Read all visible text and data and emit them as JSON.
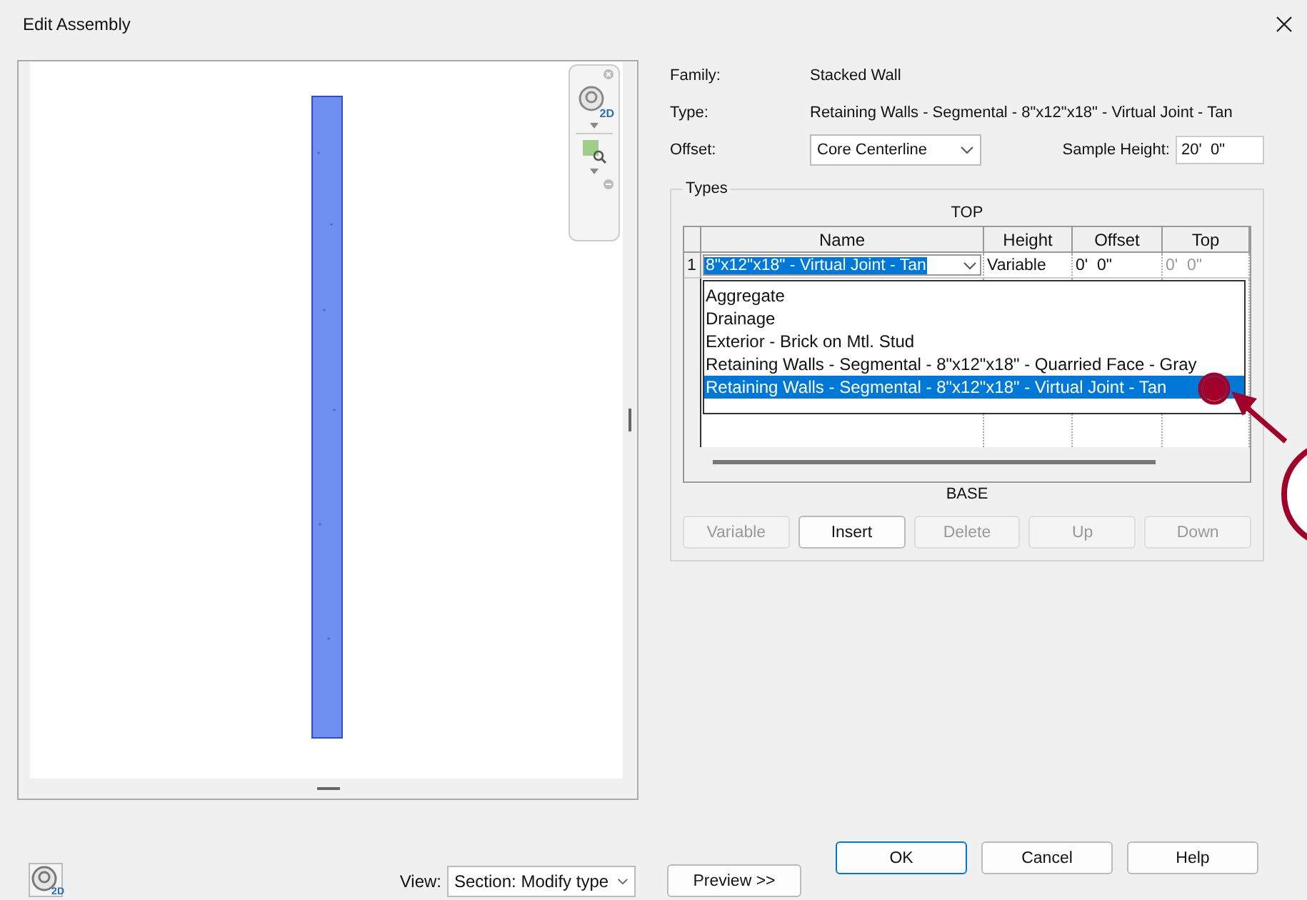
{
  "window": {
    "title": "Edit Assembly"
  },
  "preview": {
    "nav_bar_label": "2D",
    "view_label": "View:",
    "view_value": "Section: Modify type",
    "corner_label": "2D"
  },
  "properties": [
    {
      "label": "Family:",
      "value": "Stacked Wall",
      "kind": "text"
    },
    {
      "label": "Type:",
      "value": "Retaining Walls - Segmental - 8\"x12\"x18\" - Virtual Joint - Tan",
      "kind": "text"
    },
    {
      "label": "Offset:",
      "value": "Core Centerline",
      "kind": "dropdown"
    }
  ],
  "sample_height": {
    "label": "Sample Height:",
    "value": "20'  0\""
  },
  "types": {
    "title": "Types",
    "top_label": "TOP",
    "base_label": "BASE",
    "columns": [
      "Name",
      "Height",
      "Offset",
      "Top"
    ],
    "rows": [
      {
        "number": "1",
        "name": "8\"x12\"x18\" - Virtual Joint - Tan",
        "height": "Variable",
        "offset": "0'  0\"",
        "top": "0'  0\""
      }
    ],
    "dropdown_options": [
      {
        "label": "Aggregate",
        "selected": false
      },
      {
        "label": "Drainage",
        "selected": false
      },
      {
        "label": "Exterior - Brick on Mtl. Stud",
        "selected": false
      },
      {
        "label": "Retaining Walls - Segmental - 8\"x12\"x18\" - Quarried Face - Gray",
        "selected": false
      },
      {
        "label": "Retaining Walls - Segmental - 8\"x12\"x18\" - Virtual Joint - Tan",
        "selected": true
      }
    ],
    "buttons": [
      {
        "label": "Variable",
        "disabled": true
      },
      {
        "label": "Insert",
        "disabled": false
      },
      {
        "label": "Delete",
        "disabled": true
      },
      {
        "label": "Up",
        "disabled": true
      },
      {
        "label": "Down",
        "disabled": true
      }
    ]
  },
  "preview_button": "Preview >>",
  "dialog_buttons": [
    {
      "label": "OK",
      "default": true
    },
    {
      "label": "Cancel",
      "default": false
    },
    {
      "label": "Help",
      "default": false
    }
  ]
}
